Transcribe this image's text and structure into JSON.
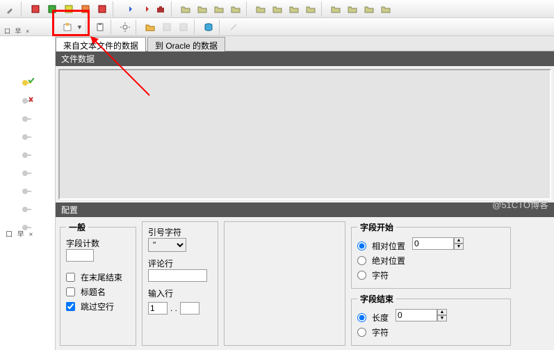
{
  "toolbar2_text": "口 早 ×",
  "left_footer": "口 早 ×",
  "tabs": {
    "active": "来自文本文件的数据",
    "inactive": "到 Oracle 的数据"
  },
  "section_file": "文件数据",
  "section_config": "配置",
  "general": {
    "legend": "一般",
    "field_count": "字段计数",
    "field_count_val": "",
    "cb_end": "在末尾结束",
    "cb_header": "标题名",
    "cb_skip": "跳过空行"
  },
  "quote": {
    "quote_char": "引号字符",
    "quote_val": "\"",
    "comment_row": "评论行",
    "comment_val": "",
    "input_row": "输入行",
    "input_from": "1",
    "input_dots": ". ."
  },
  "field_start": {
    "legend": "字段开始",
    "r_rel": "相对位置",
    "r_abs": "绝对位置",
    "r_char": "字符",
    "val": "0"
  },
  "field_end": {
    "legend": "字段结束",
    "r_len": "长度",
    "r_char": "字符",
    "val": "0"
  },
  "watermark": "@51CTO博客"
}
